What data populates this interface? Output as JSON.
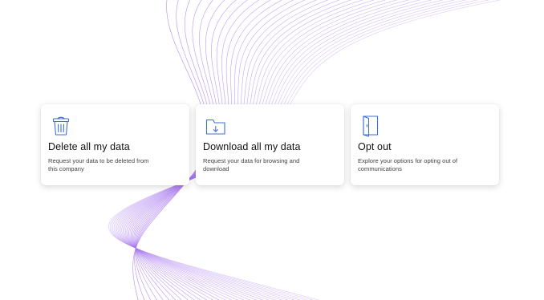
{
  "colors": {
    "accent": "#3b6fd8",
    "wave": "#a878ee"
  },
  "cards": [
    {
      "title": "Delete all my data",
      "description": "Request your data to be deleted from this company",
      "icon": "trash-icon"
    },
    {
      "title": "Download all my data",
      "description": "Request your data for browsing and download",
      "icon": "folder-download-icon"
    },
    {
      "title": "Opt out",
      "description": "Explore your options for opting out of communications",
      "icon": "door-exit-icon"
    }
  ]
}
